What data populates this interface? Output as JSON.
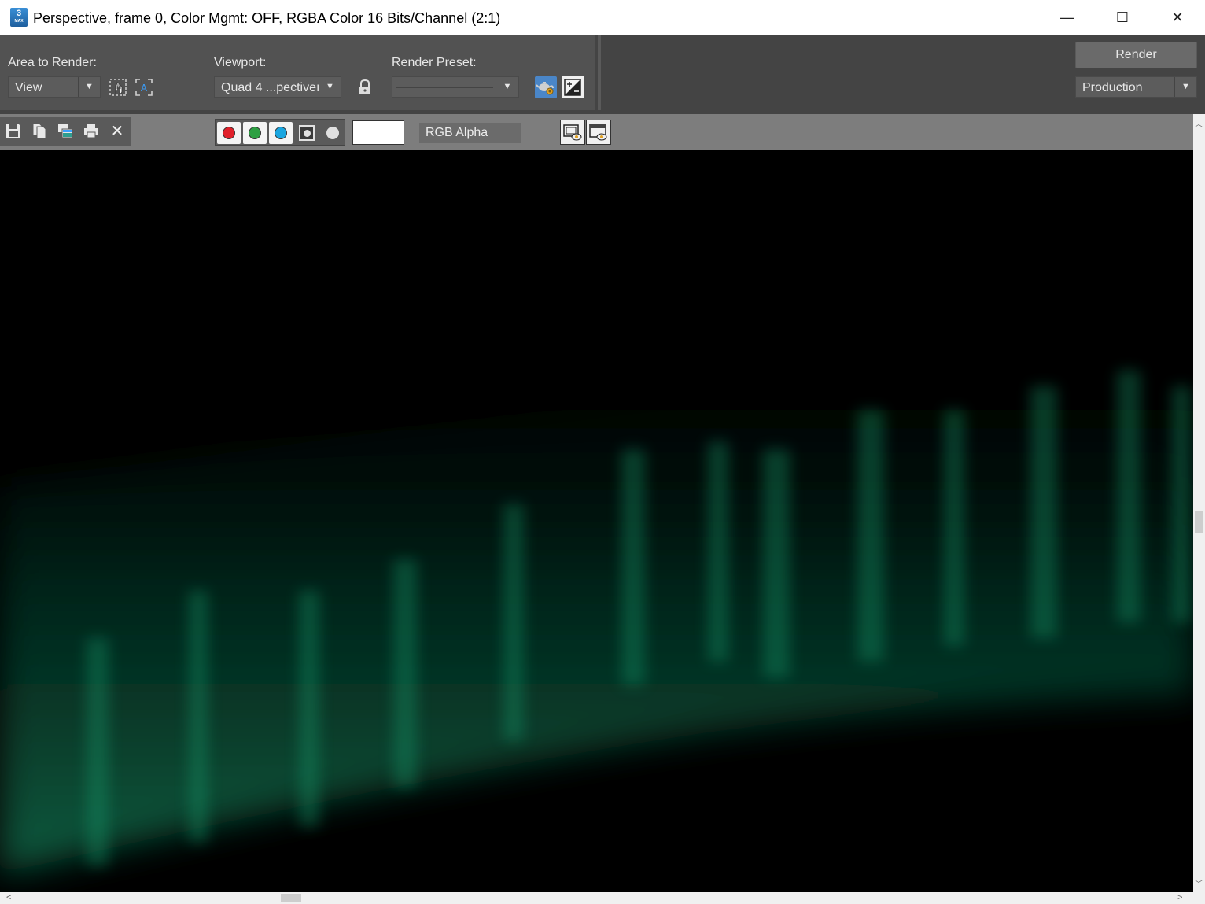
{
  "window": {
    "title": "Perspective, frame 0, Color Mgmt: OFF, RGBA Color 16 Bits/Channel (2:1)",
    "app_icon_text": "3",
    "app_icon_subtext": "MAX",
    "minimize_glyph": "—",
    "maximize_glyph": "☐",
    "close_glyph": "✕"
  },
  "render_panel": {
    "area_label": "Area to Render:",
    "area_value": "View",
    "viewport_label": "Viewport:",
    "viewport_value": "Quad 4 ...pectiveı",
    "preset_label": "Render Preset:",
    "preset_value": "",
    "render_button": "Render",
    "render_mode_value": "Production"
  },
  "frame_toolbar": {
    "channel_dropdown_value": "RGB Alpha",
    "swatch_color": "#ffffff",
    "channels": [
      {
        "name": "red",
        "color": "#e0202a",
        "active": true
      },
      {
        "name": "green",
        "color": "#2ea043",
        "active": true
      },
      {
        "name": "blue",
        "color": "#1aa6e0",
        "active": true
      },
      {
        "name": "alpha",
        "color": "#7a7a7a",
        "active": false
      },
      {
        "name": "mono",
        "color": "#e0e0e0",
        "active": false
      }
    ]
  },
  "icons": {
    "dropdown_arrow": "▼",
    "lock": "🔒",
    "close_image": "✕"
  },
  "colors": {
    "panel_bg": "#525252",
    "aurora": "#0f7a55"
  }
}
